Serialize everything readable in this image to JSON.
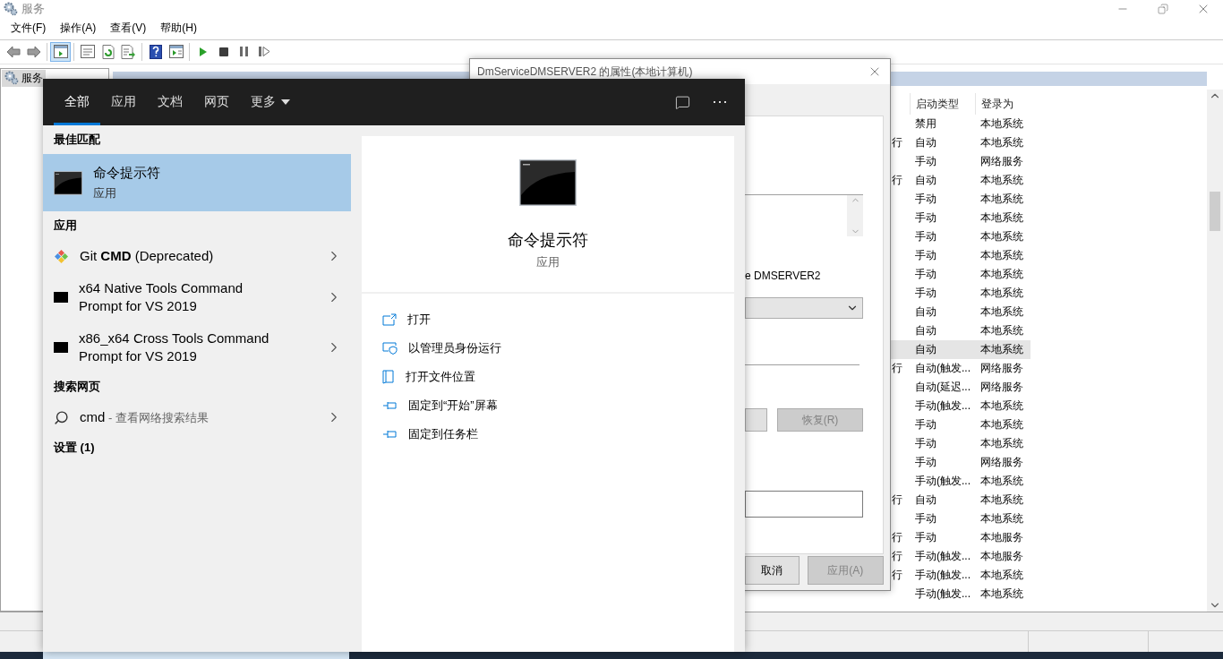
{
  "window": {
    "title": "服务"
  },
  "menu": [
    {
      "label": "文件(F)"
    },
    {
      "label": "操作(A)"
    },
    {
      "label": "查看(V)"
    },
    {
      "label": "帮助(H)"
    }
  ],
  "toolbar": [
    {
      "buttons": [
        {
          "kind": "back",
          "selected": false
        },
        {
          "kind": "forward",
          "selected": false
        }
      ]
    },
    {
      "buttons": [
        {
          "kind": "tree",
          "selected": true
        }
      ]
    },
    {
      "buttons": [
        {
          "kind": "properties",
          "selected": false
        },
        {
          "kind": "refresh",
          "selected": false
        },
        {
          "kind": "export",
          "selected": false
        }
      ]
    },
    {
      "buttons": [
        {
          "kind": "help",
          "selected": false
        },
        {
          "kind": "console",
          "selected": false
        }
      ]
    },
    {
      "buttons": [
        {
          "kind": "start",
          "selected": false
        },
        {
          "kind": "stop",
          "selected": false
        },
        {
          "kind": "pause",
          "selected": false
        },
        {
          "kind": "resume",
          "selected": false
        }
      ]
    }
  ],
  "tree": [
    {
      "label": "服务",
      "selected": true
    }
  ],
  "services_list": {
    "columns": [
      "启动类型",
      "登录为"
    ],
    "rows": [
      {
        "startup": "禁用",
        "logon": "本地系统",
        "selected": false
      },
      {
        "status": "行",
        "startup": "自动",
        "logon": "本地系统",
        "selected": false
      },
      {
        "startup": "手动",
        "logon": "网络服务",
        "selected": false
      },
      {
        "status": "行",
        "startup": "自动",
        "logon": "本地系统",
        "selected": false
      },
      {
        "startup": "手动",
        "logon": "本地系统",
        "selected": false
      },
      {
        "startup": "手动",
        "logon": "本地系统",
        "selected": false
      },
      {
        "startup": "手动",
        "logon": "本地系统",
        "selected": false
      },
      {
        "startup": "手动",
        "logon": "本地系统",
        "selected": false
      },
      {
        "startup": "手动",
        "logon": "本地系统",
        "selected": false
      },
      {
        "startup": "手动",
        "logon": "本地系统",
        "selected": false
      },
      {
        "startup": "自动",
        "logon": "本地系统",
        "selected": false
      },
      {
        "startup": "自动",
        "logon": "本地系统",
        "selected": false
      },
      {
        "startup": "自动",
        "logon": "本地系统",
        "selected": true
      },
      {
        "status": "行",
        "startup": "自动(触发...",
        "logon": "网络服务",
        "selected": false
      },
      {
        "startup": "自动(延迟...",
        "logon": "网络服务",
        "selected": false
      },
      {
        "startup": "手动(触发...",
        "logon": "本地系统",
        "selected": false
      },
      {
        "startup": "手动",
        "logon": "本地系统",
        "selected": false
      },
      {
        "startup": "手动",
        "logon": "本地系统",
        "selected": false
      },
      {
        "startup": "手动",
        "logon": "网络服务",
        "selected": false
      },
      {
        "startup": "手动(触发...",
        "logon": "本地系统",
        "selected": false
      },
      {
        "status": "行",
        "startup": "自动",
        "logon": "本地系统",
        "selected": false
      },
      {
        "startup": "手动",
        "logon": "本地系统",
        "selected": false
      },
      {
        "status": "行",
        "startup": "手动",
        "logon": "本地服务",
        "selected": false
      },
      {
        "status": "行",
        "startup": "手动(触发...",
        "logon": "本地服务",
        "selected": false
      },
      {
        "status": "行",
        "startup": "手动(触发...",
        "logon": "本地系统",
        "selected": false
      },
      {
        "startup": "手动(触发...",
        "logon": "本地系统",
        "selected": false
      }
    ]
  },
  "properties_dialog": {
    "title": "DmServiceDMSERVER2 的属性(本地计算机)",
    "server_text": "e DMSERVER2",
    "service_buttons": [
      {
        "kind": "cut",
        "disabled": false
      },
      {
        "kind": "labeled",
        "label": "恢复(R)",
        "disabled": true
      }
    ],
    "footer_buttons": [
      {
        "label": "取消",
        "disabled": false
      },
      {
        "label": "应用(A)",
        "disabled": true
      }
    ]
  },
  "start_menu": {
    "tabs": [
      {
        "label": "全部",
        "selected": true,
        "dropdown": false
      },
      {
        "label": "应用",
        "selected": false,
        "dropdown": false
      },
      {
        "label": "文档",
        "selected": false,
        "dropdown": false
      },
      {
        "label": "网页",
        "selected": false,
        "dropdown": false
      },
      {
        "label": "更多",
        "selected": false,
        "dropdown": true
      }
    ],
    "best_match": {
      "header": "最佳匹配",
      "title": "命令提示符",
      "subtitle": "应用",
      "selected": true
    },
    "sections": [
      {
        "header": "应用",
        "items": [
          {
            "kind": "git",
            "label": "Git **CMD** (Deprecated)"
          },
          {
            "kind": "console",
            "label": "x64 Native Tools Command\nPrompt for VS 2019"
          },
          {
            "kind": "console",
            "label": "x86_x64 Cross Tools Command\nPrompt for VS 2019"
          }
        ]
      },
      {
        "header": "搜索网页",
        "items": [
          {
            "kind": "search",
            "label": "cmd",
            "hint": "- 查看网络搜索结果"
          }
        ]
      },
      {
        "header": "设置 (1)"
      }
    ],
    "detail": {
      "title": "命令提示符",
      "subtitle": "应用",
      "actions": [
        {
          "kind": "open",
          "label": "打开"
        },
        {
          "kind": "admin",
          "label": "以管理员身份运行"
        },
        {
          "kind": "folder",
          "label": "打开文件位置"
        },
        {
          "kind": "pin",
          "label": "固定到“开始”屏幕"
        },
        {
          "kind": "pin",
          "label": "固定到任务栏"
        }
      ]
    }
  }
}
